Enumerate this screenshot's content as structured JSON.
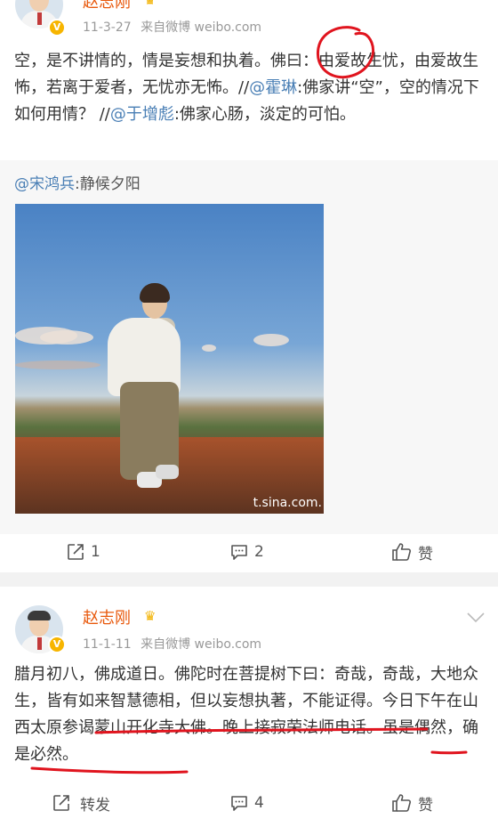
{
  "posts": [
    {
      "username": "赵志刚",
      "time": "11-3-27",
      "source_prefix": "来自",
      "source": "微博 weibo.com",
      "text": {
        "part1": "空，是不讲情的，情是妄想和执着。佛曰：由爱故生忧，由爱故生怖，若离于爱者，无忧亦无怖。//",
        "mention1": "@霍琳",
        "part2": ":佛家讲“空”，空的情况下如何用情？ //",
        "mention2": "@于增彪",
        "part3": ":佛家心肠，淡定的可怕。"
      },
      "repost": {
        "mention": "@宋鸿兵",
        "text": ":静候夕阳",
        "image_watermark": "t.sina.com."
      },
      "actions": {
        "share_count": "1",
        "comment_count": "2",
        "like_label": "赞"
      }
    },
    {
      "username": "赵志刚",
      "time": "11-1-11",
      "source_prefix": "来自",
      "source": "微博 weibo.com",
      "text": "腊月初八，佛成道日。佛陀时在菩提树下曰：奇哉，奇哉，大地众生，皆有如来智慧德相，但以妄想执著，不能证得。今日下午在山西太原参谒蒙山开化寺大佛。晚上接寂荣法师电话。虽是偶然，确是必然。",
      "actions": {
        "share_label": "转发",
        "comment_count": "4",
        "like_label": "赞"
      }
    }
  ],
  "colors": {
    "username": "#e8590c",
    "mention": "#4a7fb5",
    "annotation": "#e0141e",
    "verified_badge": "#f7b500"
  },
  "icons": [
    "share-icon",
    "comment-icon",
    "like-icon",
    "crown-icon",
    "verified-badge",
    "chevron-down-icon"
  ]
}
